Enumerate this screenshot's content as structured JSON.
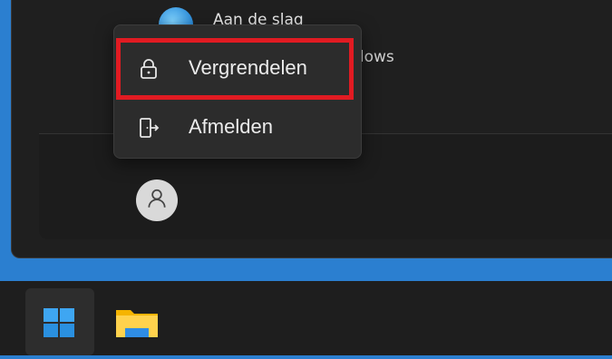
{
  "start_menu": {
    "pinned_app": {
      "label": "Aan de slag",
      "icon": "get-started-icon"
    },
    "partial_text": "ndows"
  },
  "power_flyout": {
    "items": [
      {
        "label": "Vergrendelen",
        "icon": "lock-icon",
        "highlighted": true
      },
      {
        "label": "Afmelden",
        "icon": "sign-out-icon"
      }
    ]
  },
  "user": {
    "icon": "user-avatar-icon"
  },
  "taskbar": {
    "items": [
      {
        "name": "start",
        "icon": "windows-logo-icon"
      },
      {
        "name": "file-explorer",
        "icon": "folder-icon"
      }
    ]
  },
  "colors": {
    "desktop": "#2b7fd0",
    "menu_bg": "#1f1f1f",
    "flyout_bg": "#2c2c2c",
    "highlight": "#e11b22",
    "taskbar": "#1e1e1e"
  }
}
